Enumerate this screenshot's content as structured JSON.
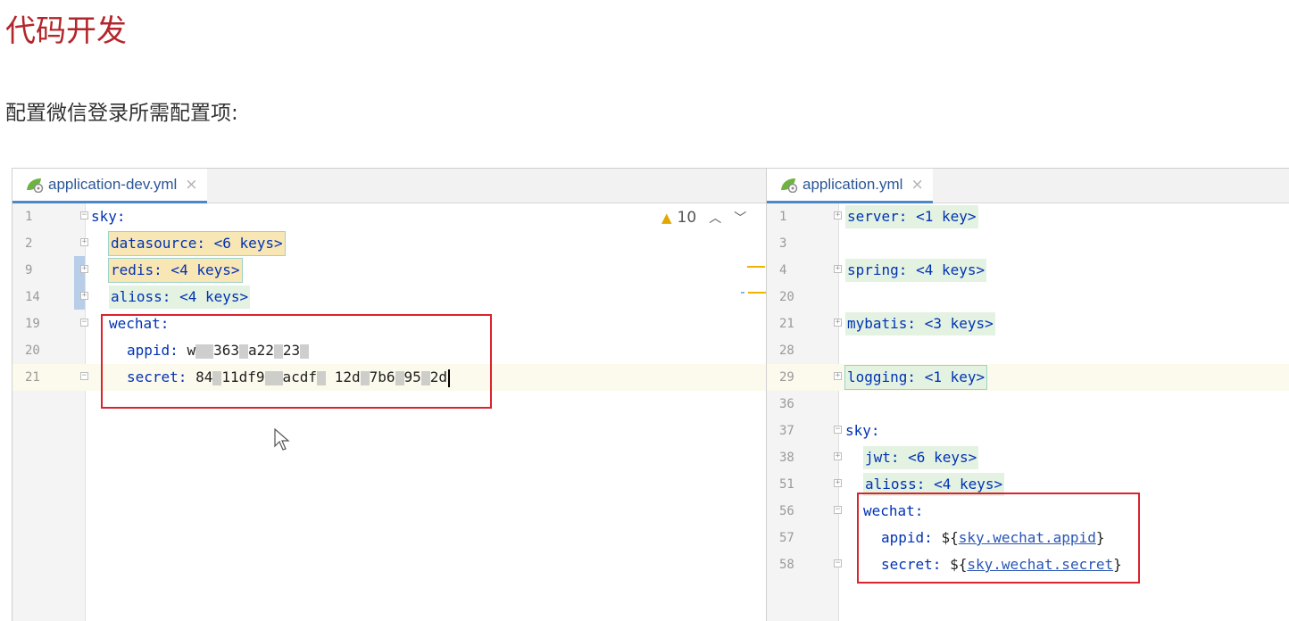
{
  "title": "代码开发",
  "subtitle": "配置微信登录所需配置项:",
  "left_editor": {
    "tab": {
      "label": "application-dev.yml",
      "close": "×",
      "icon": "spring-leaf-icon"
    },
    "warnings": {
      "icon": "warning-icon",
      "count": "10",
      "up": "^",
      "down": "v"
    },
    "lines": [
      {
        "num": "1",
        "key": "sky:",
        "rest": ""
      },
      {
        "num": "2",
        "key": "datasource: <6 keys>",
        "rest": ""
      },
      {
        "num": "9",
        "key": "redis: <4 keys>",
        "rest": ""
      },
      {
        "num": "14",
        "key": "alioss: <4 keys>",
        "rest": ""
      },
      {
        "num": "19",
        "key": "wechat:",
        "rest": ""
      },
      {
        "num": "20",
        "key": "appid:",
        "rest": "w",
        "v2": "363",
        "v3": "a22",
        "v4": "23"
      },
      {
        "num": "21",
        "key": "secret:",
        "rest": "84",
        "v2": "11df9",
        "v3": "acdf",
        "v4": "12d",
        "v5": "7b6",
        "v6": "95",
        "v7": "2d"
      }
    ]
  },
  "right_editor": {
    "tab": {
      "label": "application.yml",
      "close": "×",
      "icon": "spring-leaf-icon"
    },
    "lines": [
      {
        "num": "1",
        "text": "server: <1 key>"
      },
      {
        "num": "3",
        "text": ""
      },
      {
        "num": "4",
        "text": "spring: <4 keys>"
      },
      {
        "num": "20",
        "text": ""
      },
      {
        "num": "21",
        "text": "mybatis: <3 keys>"
      },
      {
        "num": "28",
        "text": ""
      },
      {
        "num": "29",
        "text": "logging: <1 key>"
      },
      {
        "num": "36",
        "text": ""
      },
      {
        "num": "37",
        "text": "sky:"
      },
      {
        "num": "38",
        "text": "jwt: <6 keys>"
      },
      {
        "num": "51",
        "text": "alioss: <4 keys>"
      },
      {
        "num": "56",
        "text": "wechat:"
      },
      {
        "num": "57",
        "key": "appid:",
        "prefix": "${",
        "ref": "sky.wechat.appid",
        "suffix": "}"
      },
      {
        "num": "58",
        "key": "secret:",
        "prefix": "${",
        "ref": "sky.wechat.secret",
        "suffix": "}"
      }
    ]
  },
  "colors": {
    "title": "#b4262b",
    "highlight_box": "#d9232d",
    "keyword": "#0033b3",
    "fold_bg": "#e4f2e2"
  }
}
